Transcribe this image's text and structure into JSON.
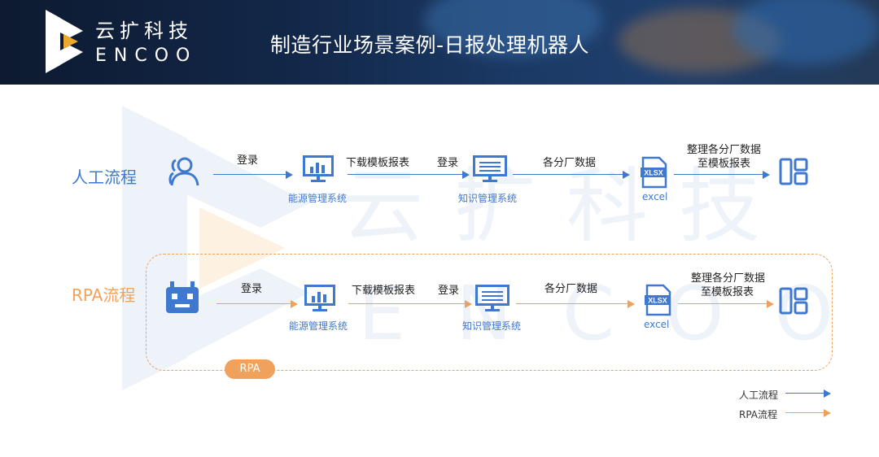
{
  "header": {
    "brand_cn": "云扩科技",
    "brand_en": "ENCOO",
    "title": "制造行业场景案例-日报处理机器人"
  },
  "watermark": {
    "cn": "云扩科技",
    "en": "ENCOO"
  },
  "colors": {
    "manual": "#3f78cf",
    "rpa": "#f0a25c",
    "header_dark": "#0d1a30"
  },
  "manual_flow": {
    "label": "人工流程",
    "actor_icon": "user-icon",
    "step1_label": "登录",
    "step2_caption": "能源管理系统",
    "step2_label": "下载模板报表",
    "step3_label": "登录",
    "step3_caption": "知识管理系统",
    "step4_label": "各分厂数据",
    "step4_caption": "excel",
    "file_badge": "XLSX",
    "step5_label_line1": "整理各分厂数据",
    "step5_label_line2": "至模板报表"
  },
  "rpa_flow": {
    "label": "RPA流程",
    "actor_icon": "robot-icon",
    "step1_label": "登录",
    "step2_caption": "能源管理系统",
    "step2_label": "下载模板报表",
    "step3_label": "登录",
    "step3_caption": "知识管理系统",
    "step4_label": "各分厂数据",
    "step4_caption": "excel",
    "file_badge": "XLSX",
    "step5_label_line1": "整理各分厂数据",
    "step5_label_line2": "至模板报表",
    "badge": "RPA"
  },
  "legend": {
    "manual": "人工流程",
    "rpa": "RPA流程"
  }
}
